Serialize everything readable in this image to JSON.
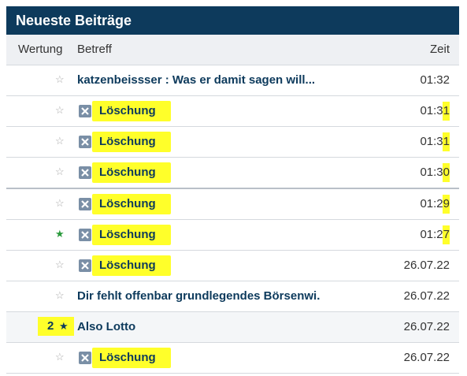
{
  "header": {
    "title": "Neueste Beiträge"
  },
  "columns": {
    "wertung": "Wertung",
    "betreff": "Betreff",
    "zeit": "Zeit"
  },
  "rows": [
    {
      "subject": "katzenbeissser : Was er damit sagen will...",
      "time": "01:32"
    },
    {
      "subject": "Löschung",
      "time": "01:31"
    },
    {
      "subject": "Löschung",
      "time": "01:31"
    },
    {
      "subject": "Löschung",
      "time": "01:30"
    },
    {
      "subject": "Löschung",
      "time": "01:29"
    },
    {
      "subject": "Löschung",
      "time": "01:27"
    },
    {
      "subject": "Löschung",
      "time": "26.07.22"
    },
    {
      "subject": "Dir fehlt offenbar grundlegendes Börsenwi.",
      "time": "26.07.22"
    },
    {
      "subject": "Also Lotto",
      "time": "26.07.22",
      "rating": "2"
    },
    {
      "subject": "Löschung",
      "time": "26.07.22"
    }
  ],
  "icons": {
    "star": "star-icon",
    "deleted": "deleted-post-icon"
  },
  "colors": {
    "header_bg": "#0d3a5c",
    "highlight": "#ffff2a",
    "link": "#0d3a5c"
  }
}
